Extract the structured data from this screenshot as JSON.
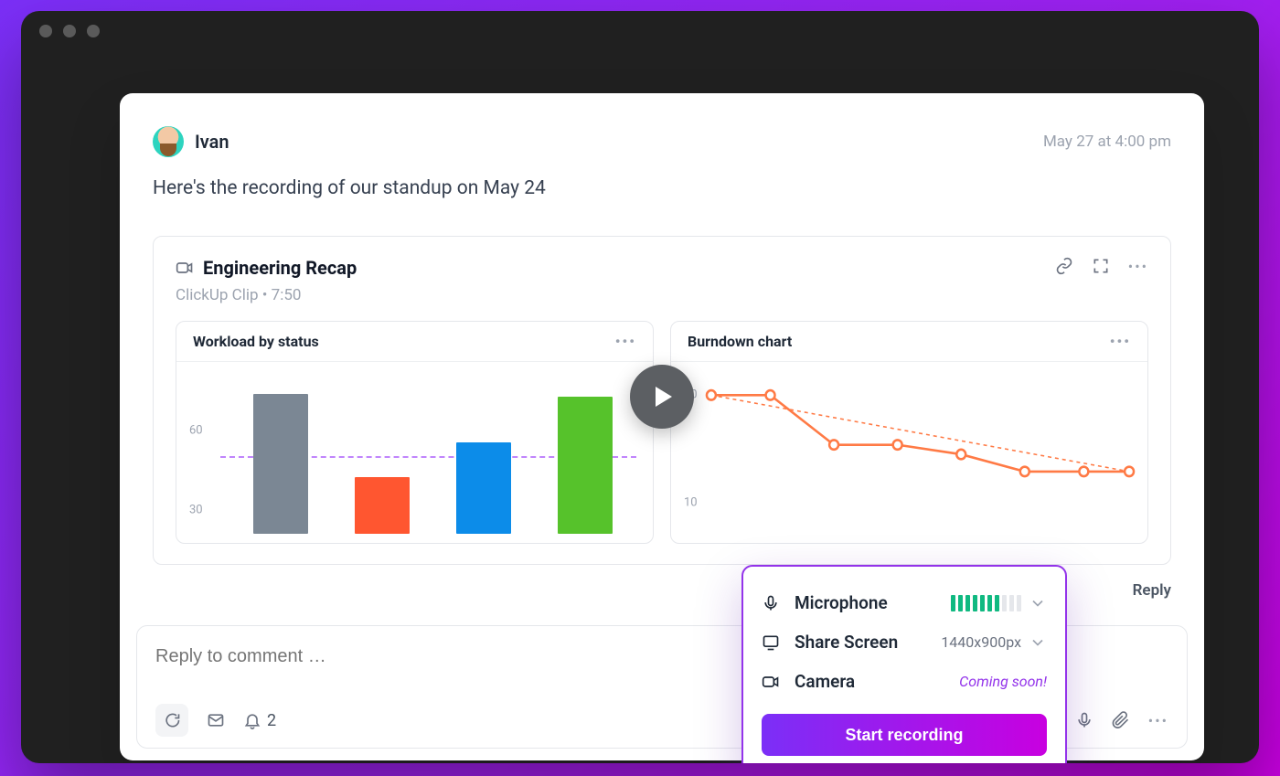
{
  "comment": {
    "author": "Ivan",
    "timestamp": "May 27 at 4:00 pm",
    "body": "Here's the recording of our standup on May 24"
  },
  "clip": {
    "title": "Engineering Recap",
    "meta": "ClickUp Clip • 7:50"
  },
  "charts": {
    "workload": {
      "title": "Workload by status"
    },
    "burndown": {
      "title": "Burndown chart"
    }
  },
  "chart_data": [
    {
      "type": "bar",
      "title": "Workload by status",
      "categories": [
        "Gray",
        "Red",
        "Blue",
        "Green"
      ],
      "values": [
        70,
        32,
        50,
        68
      ],
      "reference_line": 45,
      "ylim": [
        0,
        80
      ],
      "y_ticks": [
        30,
        60
      ]
    },
    {
      "type": "line",
      "title": "Burndown chart",
      "x": [
        1,
        2,
        3,
        4,
        5,
        6,
        7,
        8
      ],
      "series": [
        {
          "name": "actual",
          "values": [
            20,
            20,
            14,
            14,
            13,
            11,
            11,
            11
          ]
        },
        {
          "name": "ideal",
          "values": [
            20,
            18.7,
            17.4,
            16.1,
            14.9,
            13.6,
            12.3,
            11
          ]
        }
      ],
      "ylim": [
        0,
        22
      ],
      "y_ticks": [
        10,
        20
      ]
    }
  ],
  "reply": {
    "label": "Reply"
  },
  "composer": {
    "placeholder": "Reply to comment …",
    "bell_count": "2"
  },
  "popover": {
    "mic_label": "Microphone",
    "share_label": "Share Screen",
    "share_value": "1440x900px",
    "camera_label": "Camera",
    "camera_note": "Coming soon!",
    "start_label": "Start recording",
    "level_bars_on": 7,
    "level_bars_total": 10
  }
}
